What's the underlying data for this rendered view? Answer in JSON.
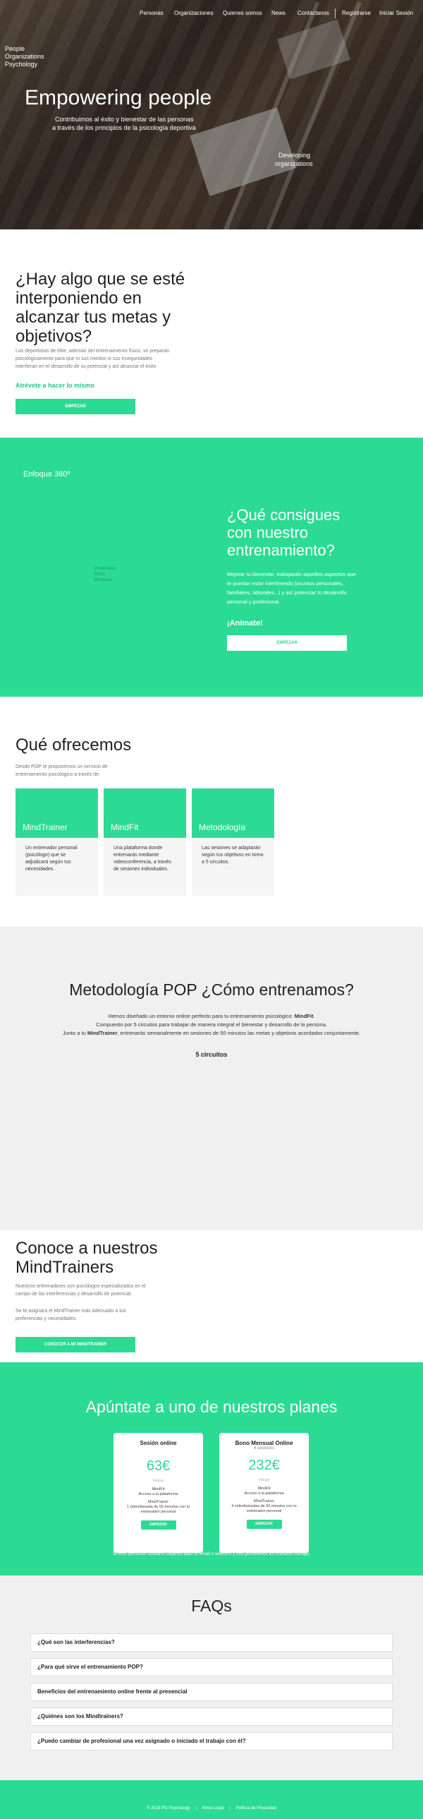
{
  "nav": {
    "items": [
      "Personas",
      "Organizaciones",
      "Quienes somos",
      "News",
      "Contáctanos",
      "Registrarse",
      "Iniciar Sesión"
    ]
  },
  "hero": {
    "logo": [
      "People",
      "Organizations",
      "Psychology"
    ],
    "title": "Empowering people",
    "subtitle": [
      "Contribuimos al éxito y bienestar de las personas",
      "a través de los principios de la psicología deportiva"
    ],
    "side": [
      "Developing",
      "organizations"
    ]
  },
  "intro": {
    "heading": [
      "¿Hay algo que se esté",
      "interponiendo en",
      "alcanzar tus metas y",
      "objetivos?"
    ],
    "text": [
      "Los deportistas de élite, además del entrenamiento físico, se preparan",
      "psicológicamente para que ni sus miedos ni sus inseguridades",
      "interfieran en el desarrollo de su potencial y así alcanzar el éxito."
    ],
    "cta_text": "Atrévete a hacer lo mismo",
    "button": "EMPEZAR"
  },
  "enfoque": {
    "label": "Enfoque 360º",
    "diagram": [
      "Profesional",
      "Estilo",
      "Bienestar"
    ],
    "heading": [
      "¿Qué consigues",
      "con nuestro",
      "entrenamiento?"
    ],
    "text": [
      "Mejorar tu bienestar, trabajando aquellos aspectos que",
      "te puedan estar interfiriendo (asuntos personales,",
      "familiares, laborales...) y así potenciar tu desarrollo",
      "personal y profesional."
    ],
    "cta": "¡Anímate!",
    "button": "EMPEZAR"
  },
  "ofrecemos": {
    "heading": "Qué ofrecemos",
    "text": [
      "Desde POP te proponemos un servicio de",
      "entrenamiento psicológico a través de:"
    ],
    "cards": [
      {
        "title": "MindTrainer",
        "text": [
          "Un entrenador personal",
          "(psicólogo) que se",
          "adjudicará según tus",
          "necesidades."
        ]
      },
      {
        "title": "MindFit",
        "text": [
          "Una plataforma donde",
          "entrenarás mediante",
          "videoconferencia, a través",
          "de sesiones individuales."
        ]
      },
      {
        "title": "Metodología",
        "text": [
          "Las sesiones se adaptarán",
          "según tus objetivos en torno",
          "a 5 circuitos."
        ]
      }
    ]
  },
  "metodologia": {
    "heading": "Metodología POP ¿Cómo entrenamos?",
    "l1a": "Hemos diseñado un entorno online perfecto para tu entrenamiento psicológico: ",
    "l1b": "MindFit",
    "l1c": ".",
    "l2": "Compuesto por 5 circuitos para trabajar de manera integral el bienestar y desarrollo de la persona.",
    "l3a": "Junto a tu ",
    "l3b": "MindTrainer",
    "l3c": ", entrenarás semanalmente en sesiones de 50 minutos las metas y objetivos acordados conjuntamente.",
    "circuitos": "5 circuitos"
  },
  "trainers": {
    "heading": [
      "Conoce a nuestros",
      "MindTrainers"
    ],
    "text1": [
      "Nuestros entrenadores son psicólogos especializados en el",
      "campo de las interferencias y desarrollo de potencial."
    ],
    "text2": [
      "Se te asignará el MindTrainer más adecuado a tus",
      "preferencias y necesidades."
    ],
    "button": "CONOCER A MI MINDTRAINER"
  },
  "planes": {
    "heading": "Apúntate a uno de nuestros planes",
    "plans": [
      {
        "name": "Sesión online",
        "sub": "",
        "price": "63€",
        "label": "Incluye",
        "f1": "MindFit",
        "f2": "Acceso a la plataforma",
        "f3": "MindTrainer",
        "f4": "1 videollamada de 50 minutos con tu",
        "f5": "entrenador personal",
        "button": "EMPEZAR"
      },
      {
        "name": "Bono Mensual Online",
        "sub": "4 sesiones",
        "price": "232€",
        "label": "Incluye",
        "f1": "MindFit",
        "f2": "Acceso a la plataforma",
        "f3": "MindTrainer",
        "f4": "4 videollamadas de 50 minutos con tu",
        "f5": "entrenador personal",
        "button": "EMPEZAR"
      }
    ],
    "note": "Si eres personal sanitario Déjanos aquí tu email o teléfono y nos pondremos en contacto contigo."
  },
  "faqs": {
    "heading": "FAQs",
    "items": [
      "¿Qué son las interferencias?",
      "¿Para qué sirve el entrenamiento POP?",
      "Beneficios del entrenamiento online frente al presencial",
      "¿Quiénes son los Mindtrainers?",
      "¿Puedo cambiar de profesional una vez asignado o iniciado el trabajo con él?"
    ]
  },
  "footer": {
    "copy": "© 2019 PO Psychology",
    "legal": "Aviso Legal",
    "privacy": "Política de Privacidad"
  }
}
